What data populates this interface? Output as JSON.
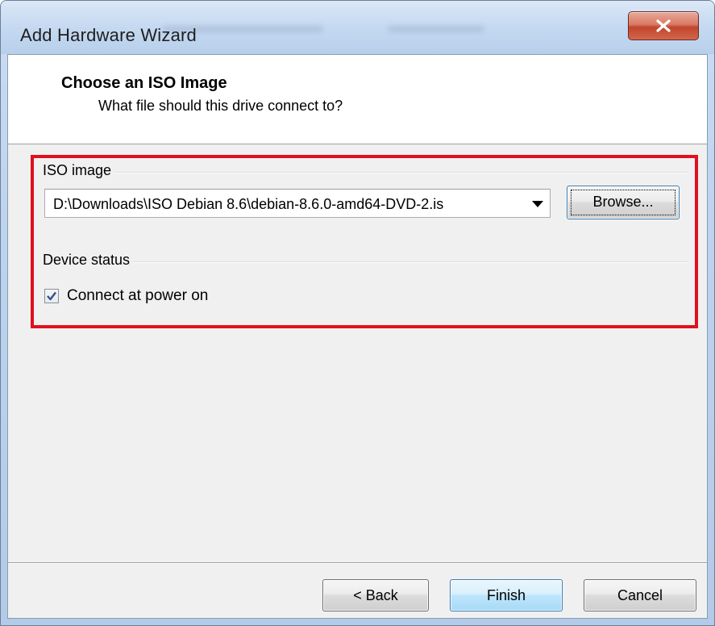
{
  "window": {
    "title": "Add Hardware Wizard"
  },
  "header": {
    "title": "Choose an ISO Image",
    "subtitle": "What file should this drive connect to?"
  },
  "iso_group": {
    "label": "ISO image",
    "path_value": "D:\\Downloads\\ISO Debian 8.6\\debian-8.6.0-amd64-DVD-2.is",
    "browse_label": "Browse..."
  },
  "device_status_group": {
    "label": "Device status",
    "connect_label": "Connect at power on",
    "connect_checked": true
  },
  "footer": {
    "back_label": "< Back",
    "finish_label": "Finish",
    "cancel_label": "Cancel"
  },
  "colors": {
    "highlight_border": "#e0101e",
    "close_button": "#c9553d",
    "dialog_background": "#f0f0f0"
  },
  "icons": {
    "close": "close-icon",
    "dropdown": "chevron-down-icon",
    "check": "checkmark-icon"
  }
}
